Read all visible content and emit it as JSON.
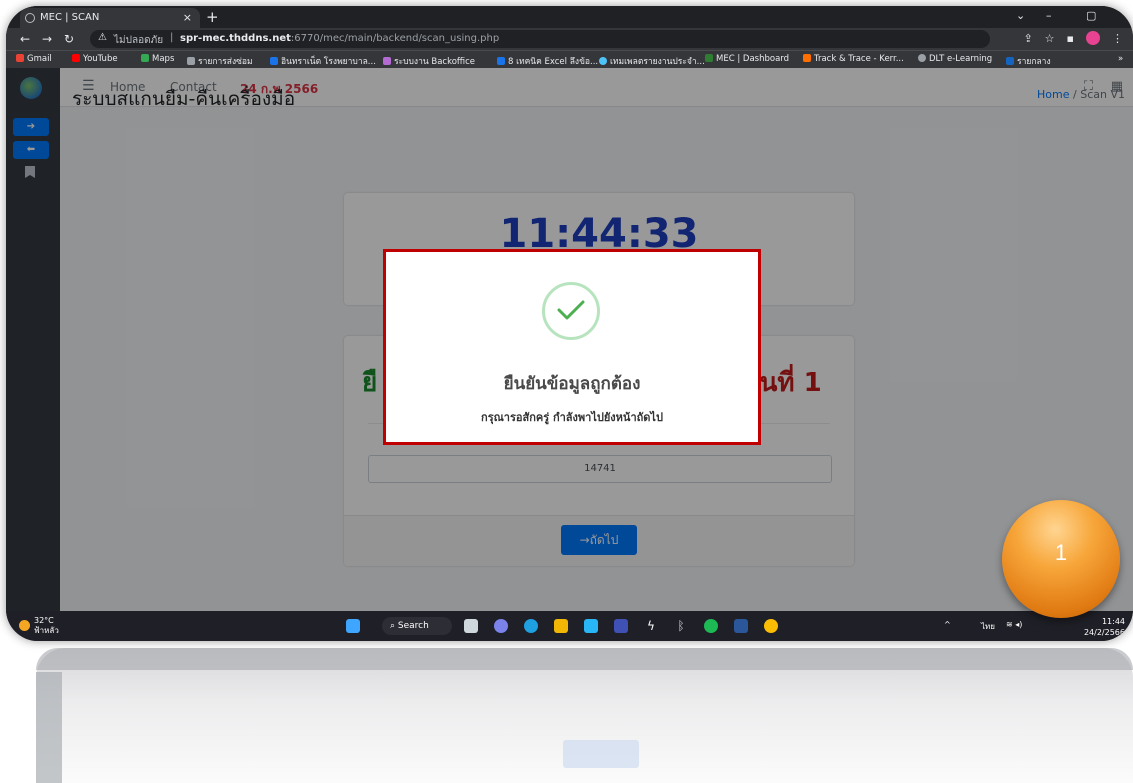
{
  "browser": {
    "tab_title": "MEC | SCAN",
    "tab_close": "×",
    "new_tab": "+",
    "insecure_label": "ไม่ปลอดภัย",
    "url_host": "spr-mec.thddns.net",
    "url_path": ":6770/mec/main/backend/scan_using.php",
    "bookmarks": [
      {
        "label": "Gmail",
        "color": "#ea4335"
      },
      {
        "label": "YouTube",
        "color": "#ff0000"
      },
      {
        "label": "Maps",
        "color": "#34a853"
      },
      {
        "label": "รายการส่งซ่อม",
        "color": "#9aa0a6"
      },
      {
        "label": "อินทราเน็ต โรงพยาบาล...",
        "color": "#1a73e8"
      },
      {
        "label": "ระบบงาน Backoffice",
        "color": "#b36ad1"
      },
      {
        "label": "8 เทคนิค Excel ลึงข้อ...",
        "color": "#1a73e8"
      },
      {
        "label": "เทมเพลตรายงานประจำ...",
        "color": "#4fc3f7"
      },
      {
        "label": "MEC | Dashboard",
        "color": "#2e7d32"
      },
      {
        "label": "Track & Trace - Kerr...",
        "color": "#ff6f00"
      },
      {
        "label": "DLT e-Learning",
        "color": "#9aa0a6"
      },
      {
        "label": "รายกลาง",
        "color": "#1565c0"
      }
    ],
    "bookmarks_more": "»"
  },
  "navbar": {
    "home": "Home",
    "contact": "Contact",
    "date": "24 ก.พ 2566"
  },
  "page": {
    "title": "ระบบสแกนยืม-คืนเครื่องมือ",
    "breadcrumb_home": "Home",
    "breadcrumb_sep": "/",
    "breadcrumb_current": "Scan V1",
    "clock": "11:44:33",
    "step_left": "ยื",
    "step_right": "อนที่ 1",
    "input_value": "14741",
    "next_button": "→ถัดไป"
  },
  "modal": {
    "title": "ยืนยันข้อมูลถูกต้อง",
    "subtitle": "กรุณารอสักครู่ กำลังพาไปยังหน้าถัดไป"
  },
  "taskbar": {
    "temperature": "32°C",
    "weather_text": "ฟ้าหลัว",
    "search": "Search",
    "language": "ไทย",
    "time": "11:44",
    "date": "24/2/2566"
  },
  "annotation_badge": "1"
}
